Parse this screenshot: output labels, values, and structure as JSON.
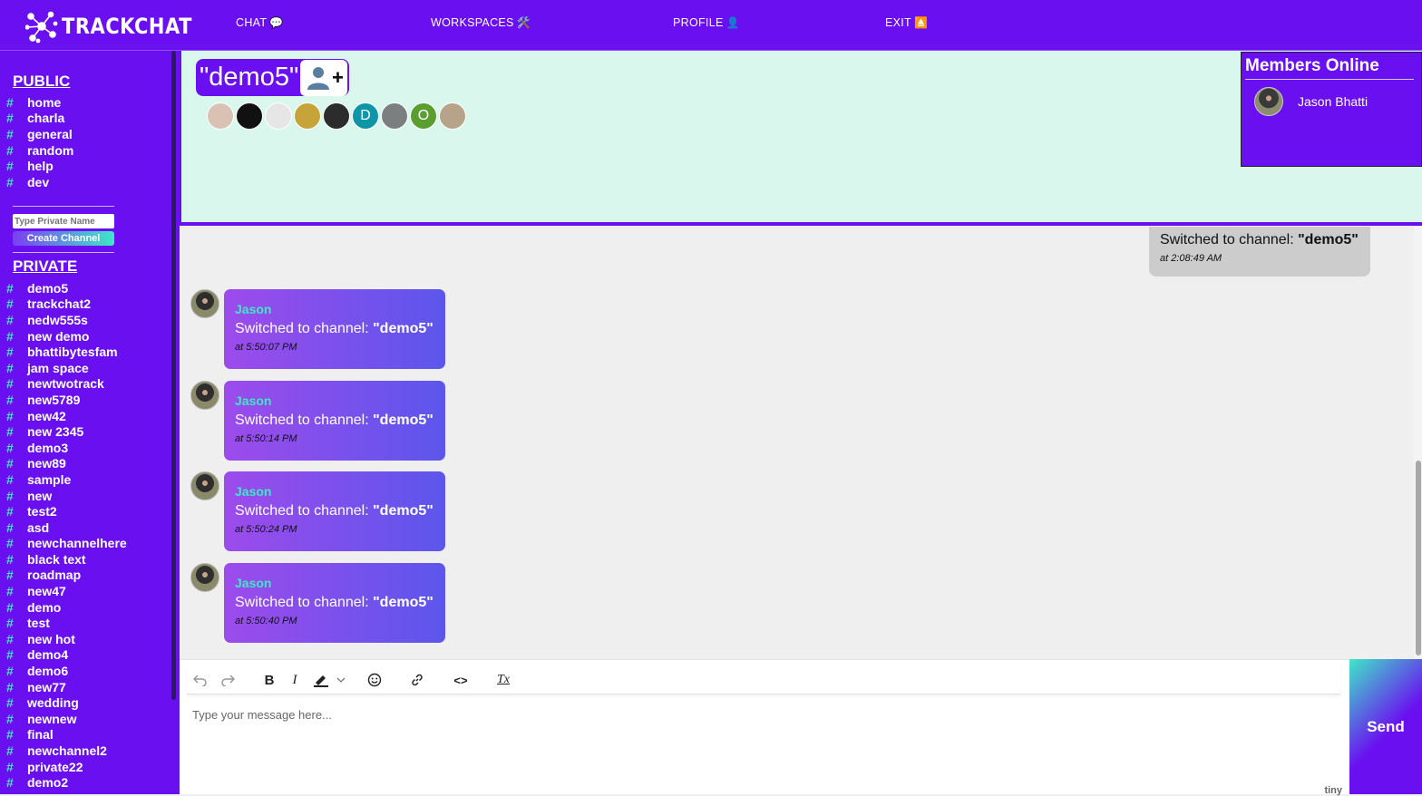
{
  "brand": {
    "name": "TRACKCHAT"
  },
  "nav": [
    {
      "label": "CHAT",
      "emoji": "💬"
    },
    {
      "label": "WORKSPACES",
      "emoji": "🛠️"
    },
    {
      "label": "PROFILE",
      "emoji": "👤"
    },
    {
      "label": "EXIT",
      "emoji": "⏏️"
    }
  ],
  "sidebar": {
    "public_title": "PUBLIC",
    "public_channels": [
      "home",
      "charla",
      "general",
      "random",
      "help",
      "dev"
    ],
    "private_name_placeholder": "Type Private Name",
    "create_channel_label": "Create Channel",
    "private_title": "PRIVATE",
    "private_channels": [
      "demo5",
      "trackchat2",
      "nedw555s",
      "new demo",
      "bhattibytesfam",
      "jam space",
      "newtwotrack",
      "new5789",
      "new42",
      "new 2345",
      "demo3",
      "new89",
      "sample",
      "new",
      "test2",
      "asd",
      "newchannelhere",
      "black text",
      "roadmap",
      "new47",
      "demo",
      "test",
      "new hot",
      "demo4",
      "demo6",
      "new77",
      "wedding",
      "newnew",
      "final",
      "newchannel2",
      "private22",
      "demo2"
    ],
    "hash": "#"
  },
  "channel_header": {
    "name": "\"demo5\"",
    "member_avatars": [
      {
        "initial": "",
        "color": "#d9c1b4"
      },
      {
        "initial": "",
        "color": "#111111"
      },
      {
        "initial": "",
        "color": "#e6e6e6"
      },
      {
        "initial": "",
        "color": "#c6a43a"
      },
      {
        "initial": "",
        "color": "#2c2c2c"
      },
      {
        "initial": "D",
        "color": "#0e96a8"
      },
      {
        "initial": "",
        "color": "#7c7f80"
      },
      {
        "initial": "O",
        "color": "#5a9e30"
      },
      {
        "initial": "",
        "color": "#b7a38a"
      }
    ]
  },
  "members_online": {
    "title": "Members Online",
    "members": [
      "Jason Bhatti"
    ]
  },
  "messages": {
    "system": {
      "text_prefix": "Switched to channel: ",
      "channel": "\"demo5\"",
      "time": "at 2:08:49 AM"
    },
    "items": [
      {
        "author": "Jason",
        "text_prefix": "Switched to channel: ",
        "channel": "\"demo5\"",
        "time": "at 5:50:07 PM"
      },
      {
        "author": "Jason",
        "text_prefix": "Switched to channel: ",
        "channel": "\"demo5\"",
        "time": "at 5:50:14 PM"
      },
      {
        "author": "Jason",
        "text_prefix": "Switched to channel: ",
        "channel": "\"demo5\"",
        "time": "at 5:50:24 PM"
      },
      {
        "author": "Jason",
        "text_prefix": "Switched to channel: ",
        "channel": "\"demo5\"",
        "time": "at 5:50:40 PM"
      }
    ]
  },
  "editor": {
    "placeholder": "Type your message here...",
    "toolbar": [
      "undo-icon",
      "redo-icon",
      "bold-icon",
      "italic-icon",
      "highlight-icon",
      "chevron-down-icon",
      "emoji-icon",
      "link-icon",
      "code-icon",
      "clear-format-icon"
    ],
    "bold_glyph": "B",
    "italic_glyph": "I",
    "code_glyph": "<>",
    "clear_glyph": "Tx",
    "branding": "tiny"
  },
  "send_label": "Send",
  "colors": {
    "primary": "#6a0ff0",
    "accent": "#3ee8c7",
    "header_bg": "#d9f7ec"
  }
}
